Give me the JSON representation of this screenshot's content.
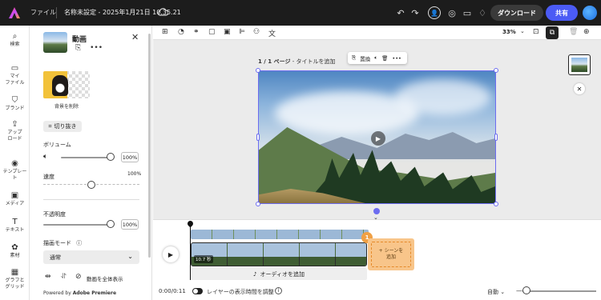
{
  "topbar": {
    "file_menu": "ファイル",
    "doc_title": "名称未設定 - 2025年1月21日 10.35.21",
    "download_label": "ダウンロード",
    "share_label": "共有",
    "icons": [
      "undo-icon",
      "redo-icon",
      "user-icon",
      "lightbulb-icon",
      "comment-icon",
      "bell-icon"
    ]
  },
  "rail": {
    "items": [
      {
        "icon": "search-icon",
        "label": "検索"
      },
      {
        "icon": "folder-icon",
        "label": "マイ\nファイル"
      },
      {
        "icon": "brand-icon",
        "label": "ブランド"
      },
      {
        "icon": "upload-icon",
        "label": "アップ\nロード"
      },
      {
        "icon": "template-icon",
        "label": "テンプレー\nト"
      },
      {
        "icon": "media-icon",
        "label": "メディア"
      },
      {
        "icon": "text-icon",
        "label": "テキスト"
      },
      {
        "icon": "elements-icon",
        "label": "素材"
      },
      {
        "icon": "grid-icon",
        "label": "グラフと\nグリッド"
      }
    ]
  },
  "panel": {
    "title": "動画",
    "remove_bg_label": "背景を削除",
    "crop_label": "切り抜き",
    "volume_label": "ボリューム",
    "volume_value": "100%",
    "volume_level": 1.0,
    "speed_label": "速度",
    "speed_value": "100%",
    "speed_level": 0.5,
    "opacity_label": "不透明度",
    "opacity_value": "100%",
    "opacity_level": 1.0,
    "blend_label": "描画モード",
    "blend_value": "通常",
    "fullscreen_label": "動画を全体表示",
    "powered_prefix": "Powered by ",
    "powered_brand": "Adobe Premiere"
  },
  "canvas": {
    "zoom": "33%",
    "page_label_bold": "1 / 1 ページ",
    "page_label_rest": " - タイトルを追加",
    "float_bar_replace": "置換"
  },
  "timeline": {
    "clip_duration": "10.7 秒",
    "add_audio": "オーディオを追加",
    "badge": "1",
    "add_scene": "+ シーンを\n追加",
    "timecode": "0:00/0:11",
    "layer_timing": "レイヤーの表示時間を調整",
    "auto": "自動",
    "zoom_level": 0.0
  },
  "colors": {
    "accent": "#4b5bf5",
    "selection": "#6c6cf0",
    "scene_orange": "#f8c58a"
  }
}
